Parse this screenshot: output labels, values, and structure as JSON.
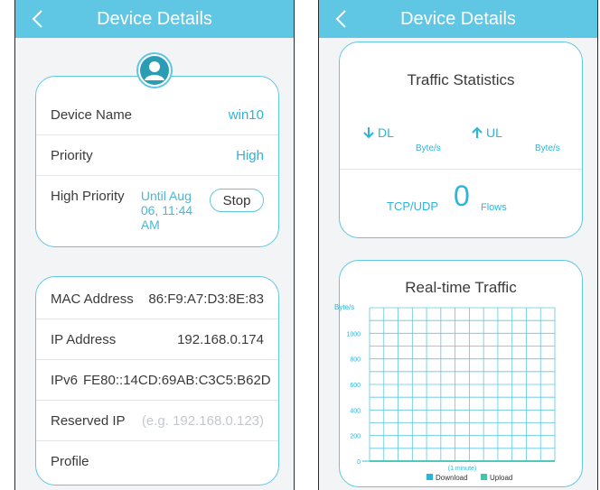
{
  "left_screen": {
    "header": {
      "title": "Device Details"
    },
    "device_card": {
      "rows": [
        {
          "label": "Device Name",
          "value": "win10"
        },
        {
          "label": "Priority",
          "value": "High"
        },
        {
          "label": "High Priority",
          "value": "Until Aug 06, 11:44 AM",
          "button": "Stop"
        }
      ]
    },
    "network_card": {
      "rows": [
        {
          "label": "MAC Address",
          "value": "86:F9:A7:D3:8E:83"
        },
        {
          "label": "IP Address",
          "value": "192.168.0.174"
        },
        {
          "label": "IPv6",
          "value": "FE80::14CD:69AB:C3C5:B62D"
        },
        {
          "label": "Reserved IP",
          "placeholder": "(e.g. 192.168.0.123)"
        },
        {
          "label": "Profile",
          "value": ""
        }
      ]
    }
  },
  "right_screen": {
    "header": {
      "title": "Device Details"
    },
    "traffic_statistics": {
      "title": "Traffic Statistics",
      "dl_label": "DL",
      "ul_label": "UL",
      "dl_unit": "Byte/s",
      "ul_unit": "Byte/s",
      "protocol_label": "TCP/UDP",
      "flows_value": "0",
      "flows_label": "Flows"
    },
    "realtime_traffic": {
      "title": "Real-time Traffic",
      "legend": [
        "Download",
        "Upload"
      ]
    }
  },
  "colors": {
    "accent": "#5fc6e4",
    "value_text": "#2bb5da",
    "download": "#2bb5da",
    "upload": "#45c4a8"
  },
  "chart_data": {
    "type": "line",
    "title": "Real-time Traffic",
    "ylabel": "Byte/s",
    "xlabel": "(1 minute)",
    "ylim": [
      0,
      1200
    ],
    "yticks": [
      "0",
      "200",
      "400",
      "600",
      "800",
      "1000"
    ],
    "x": [
      0,
      1,
      2,
      3,
      4,
      5,
      6,
      7,
      8,
      9,
      10,
      11,
      12
    ],
    "series": [
      {
        "name": "Download",
        "values": [
          0,
          0,
          0,
          0,
          0,
          0,
          0,
          0,
          0,
          0,
          0,
          0,
          0
        ]
      },
      {
        "name": "Upload",
        "values": [
          0,
          0,
          0,
          0,
          0,
          0,
          0,
          0,
          0,
          0,
          0,
          0,
          0
        ]
      }
    ],
    "grid": true,
    "legend": "bottom"
  }
}
